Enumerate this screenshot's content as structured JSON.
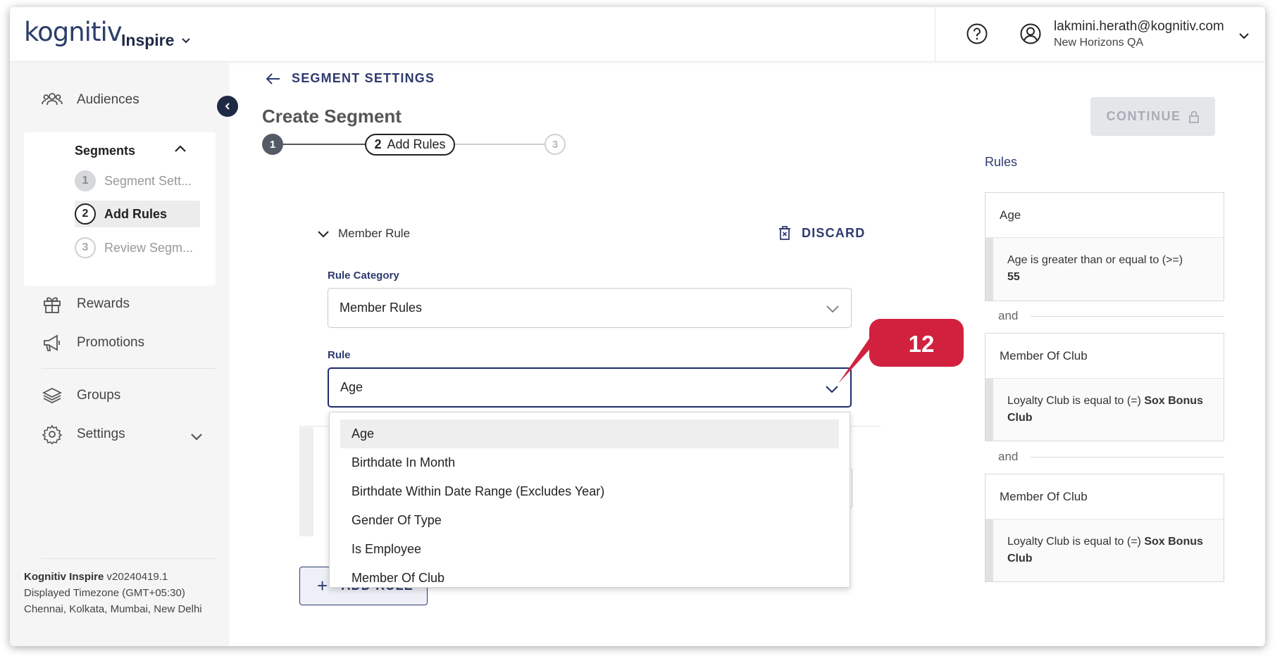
{
  "header": {
    "logo": "kognitiv",
    "app_name": "Inspire",
    "user_email": "lakmini.herath@kognitiv.com",
    "user_org": "New Horizons QA"
  },
  "sidebar": {
    "audiences": "Audiences",
    "segments": "Segments",
    "steps": [
      {
        "num": "1",
        "label": "Segment Sett..."
      },
      {
        "num": "2",
        "label": "Add Rules"
      },
      {
        "num": "3",
        "label": "Review Segm..."
      }
    ],
    "rewards": "Rewards",
    "promotions": "Promotions",
    "groups": "Groups",
    "settings": "Settings",
    "footer": {
      "product": "Kognitiv Inspire",
      "version": "v20240419.1",
      "timezone_line": "Displayed Timezone (GMT+05:30)",
      "cities": "Chennai, Kolkata, Mumbai, New Delhi"
    }
  },
  "main": {
    "back_label": "SEGMENT SETTINGS",
    "title": "Create Segment",
    "continue_label": "CONTINUE",
    "stepper": {
      "s1": "1",
      "s2_num": "2",
      "s2_label": "Add Rules",
      "s3": "3"
    },
    "rule_toggle": "Member Rule",
    "discard": "DISCARD",
    "rule_category_label": "Rule Category",
    "rule_category_value": "Member Rules",
    "rule_label": "Rule",
    "rule_value": "Age",
    "add_rule": "ADD RULE",
    "dropdown_options": [
      "Age",
      "Birthdate In Month",
      "Birthdate Within Date Range (Excludes Year)",
      "Gender Of Type",
      "Is Employee",
      "Member Of Club"
    ],
    "callout": "12"
  },
  "rules_panel": {
    "title": "Rules",
    "and_label": "and",
    "rules": [
      {
        "head": "Age",
        "text": "Age is greater than or equal to (>=)",
        "value": "55"
      },
      {
        "head": "Member Of Club",
        "text": "Loyalty Club is equal to (=)",
        "value": "Sox Bonus Club"
      },
      {
        "head": "Member Of Club",
        "text": "Loyalty Club is equal to (=)",
        "value": "Sox Bonus Club"
      }
    ]
  },
  "colors": {
    "navy": "#2e3a6e",
    "callout_red": "#d2213f",
    "logo_teal": "#1aa4b8"
  }
}
